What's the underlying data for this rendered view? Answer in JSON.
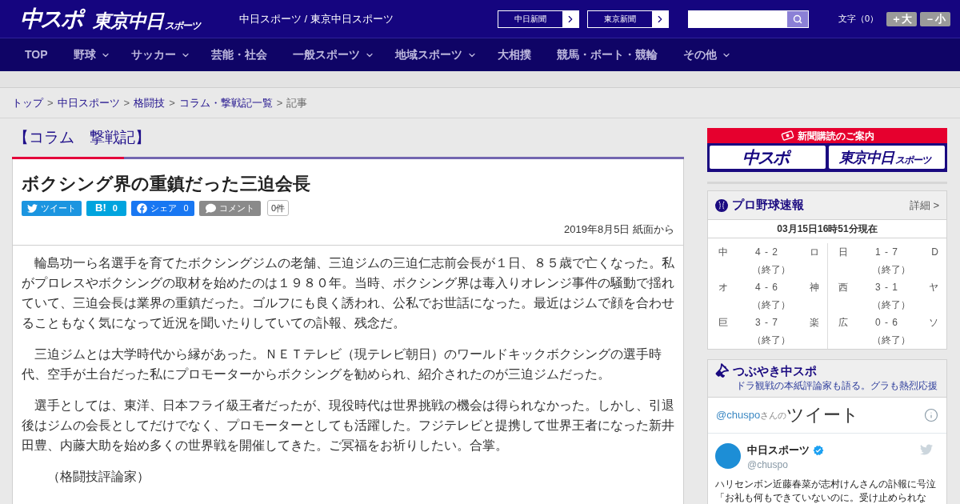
{
  "header": {
    "logos": [
      {
        "text": "中スポ"
      },
      {
        "text": "東京中日",
        "suffix": "スポーツ"
      }
    ],
    "site_name": "中日スポーツ / 東京中日スポーツ",
    "links": [
      "中日新聞",
      "東京新聞"
    ],
    "text_size": {
      "label": "文字（0）",
      "buttons": [
        "＋大",
        "－小"
      ]
    }
  },
  "nav": [
    {
      "label": "TOP",
      "dropdown": false
    },
    {
      "label": "野球",
      "dropdown": true
    },
    {
      "label": "サッカー",
      "dropdown": true
    },
    {
      "label": "芸能・社会",
      "dropdown": false
    },
    {
      "label": "一般スポーツ",
      "dropdown": true
    },
    {
      "label": "地域スポーツ",
      "dropdown": true
    },
    {
      "label": "大相撲",
      "dropdown": false
    },
    {
      "label": "競馬・ボート・競輪",
      "dropdown": false
    },
    {
      "label": "その他",
      "dropdown": true
    }
  ],
  "breadcrumb": [
    {
      "label": "トップ",
      "link": true,
      "separator": ">"
    },
    {
      "label": "中日スポーツ",
      "link": true,
      "separator": ">"
    },
    {
      "label": "格闘技",
      "link": true,
      "separator": ">"
    },
    {
      "label": "コラム・撃戦記一覧",
      "link": true,
      "separator": ">"
    },
    {
      "label": "記事",
      "link": false
    }
  ],
  "section_title": "【コラム　撃戦記】",
  "article": {
    "title": "ボクシング界の重鎮だった三迫会長",
    "share_buttons": [
      {
        "kind": "twitter",
        "label": "ツイート"
      },
      {
        "kind": "hatena",
        "label": "B!",
        "count": "0"
      },
      {
        "kind": "facebook",
        "label": "シェア",
        "count": "0"
      },
      {
        "kind": "comment",
        "label": "コメント"
      }
    ],
    "comment_count": "0件",
    "date": "2019年8月5日 紙面から",
    "paragraphs": [
      "輪島功一ら名選手を育てたボクシングジムの老舗、三迫ジムの三迫仁志前会長が１日、８５歳で亡くなった。私がプロレスやボクシングの取材を始めたのは１９８０年。当時、ボクシング界は毒入りオレンジ事件の騒動で揺れていて、三迫会長は業界の重鎮だった。ゴルフにも良く誘われ、公私でお世話になった。最近はジムで顔を合わせることもなく気になって近況を聞いたりしていての訃報、残念だ。",
      "三迫ジムとは大学時代から縁があった。ＮＥＴテレビ（現テレビ朝日）のワールドキックボクシングの選手時代、空手が土台だった私にプロモーターからボクシングを勧められ、紹介されたのが三迫ジムだった。",
      "選手としては、東洋、日本フライ級王者だったが、現役時代は世界挑戦の機会は得られなかった。しかし、引退後はジムの会長としてだけでなく、プロモーターとしても活躍した。フジテレビと提携して世界王者になった新井田豊、内藤大助を始め多くの世界戦を開催してきた。ご冥福をお祈りしたい。合掌。"
    ],
    "byline": "（格闘技評論家）"
  },
  "subscription": {
    "heading": "新聞購読のご案内",
    "logos": [
      {
        "text": "中スポ"
      },
      {
        "text": "東京中日",
        "suffix": "スポーツ"
      }
    ]
  },
  "baseball": {
    "title": "プロ野球速報",
    "detail_link": "詳細 >",
    "timestamp": "03月15日16時51分現在",
    "games": [
      {
        "home": "中",
        "score": "4 - 2",
        "away": "ロ",
        "status": "（終了）"
      },
      {
        "home": "日",
        "score": "1 - 7",
        "away": "D",
        "status": "（終了）"
      },
      {
        "home": "オ",
        "score": "4 - 6",
        "away": "神",
        "status": "（終了）"
      },
      {
        "home": "西",
        "score": "3 - 1",
        "away": "ヤ",
        "status": "（終了）"
      },
      {
        "home": "巨",
        "score": "3 - 7",
        "away": "楽",
        "status": "（終了）"
      },
      {
        "home": "広",
        "score": "0 - 6",
        "away": "ソ",
        "status": "（終了）"
      }
    ]
  },
  "tweets_widget": {
    "title": "つぶやき中スポ",
    "subtitle": "ドラ観戦の本紙評論家も語る。グラも熱烈応援",
    "handle": "@chuspo",
    "handle_suffix": "さんの",
    "heading": "ツイート",
    "tweet": {
      "name": "中日スポーツ",
      "verified": true,
      "username": "@chuspo",
      "text": "ハリセンボン近藤春菜が志村けんさんの訃報に号泣「お礼も何もできていないのに。受け止められな"
    }
  }
}
